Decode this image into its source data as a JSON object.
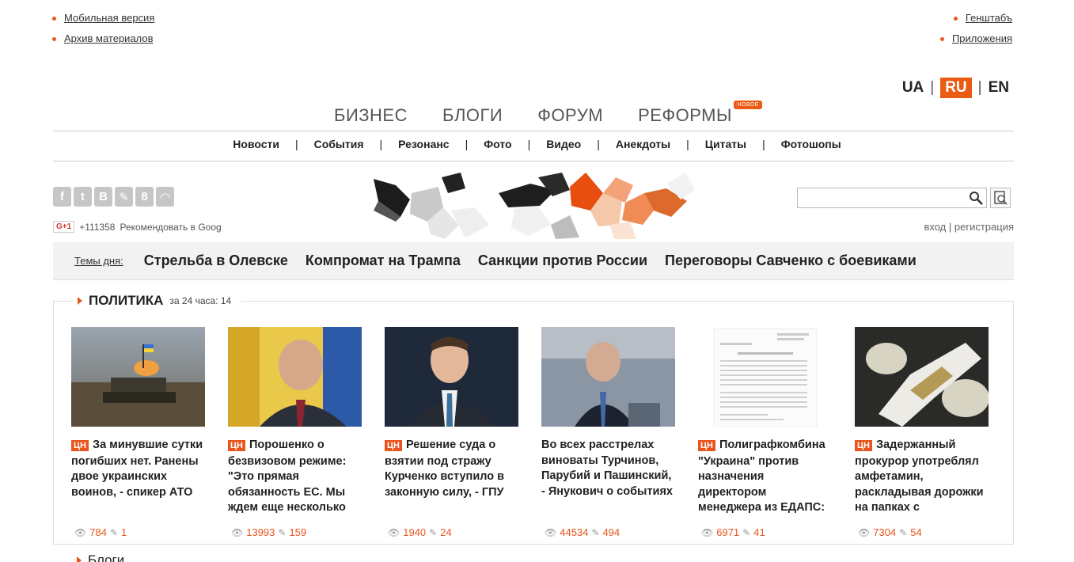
{
  "top_links_left": [
    "Мобильная версия",
    "Архив материалов"
  ],
  "top_links_right": [
    "Генштабъ",
    "Приложения"
  ],
  "languages": {
    "ua": "UA",
    "ru": "RU",
    "en": "EN",
    "sep": "|"
  },
  "main_nav": {
    "business": "БИЗНЕС",
    "blogs": "БЛОГИ",
    "forum": "ФОРУМ",
    "reforms": "РЕФОРМЫ",
    "new_badge": "НОВОЕ"
  },
  "sub_nav": [
    "Новости",
    "События",
    "Резонанс",
    "Фото",
    "Видео",
    "Анекдоты",
    "Цитаты",
    "Фотошопы"
  ],
  "sub_nav_sep": "|",
  "social_icons": [
    "facebook-icon",
    "twitter-icon",
    "vkontakte-icon",
    "livejournal-icon",
    "google-plus-icon",
    "rss-icon"
  ],
  "gplus": {
    "badge": "G+1",
    "count": "+111358",
    "text": "Рекомендовать в Goog"
  },
  "auth": {
    "login": "вход",
    "sep": "|",
    "register": "регистрация"
  },
  "topics": {
    "label": "Темы дня:",
    "items": [
      "Стрельба в Олевске",
      "Компромат на Трампа",
      "Санкции против России",
      "Переговоры Савченко с боевиками"
    ]
  },
  "section": {
    "title": "ПОЛИТИКА",
    "count_label": "за 24 часа: 14"
  },
  "cards": [
    {
      "tag": "ЦН",
      "headline": "За минувшие сутки погибших нет. Ранены двое украинских воинов, - спикер АТО",
      "views": "784",
      "comments": "1"
    },
    {
      "tag": "ЦН",
      "headline": "Порошенко о безвизовом режиме: \"Это прямая обязанность ЕС. Мы ждем еще несколько",
      "views": "13993",
      "comments": "159"
    },
    {
      "tag": "ЦН",
      "headline": "Решение суда о взятии под стражу Курченко вступило в законную силу, - ГПУ",
      "views": "1940",
      "comments": "24"
    },
    {
      "tag": "",
      "headline": "Во всех расстрелах виноваты Турчинов, Парубий и Пашинский, - Янукович о событиях",
      "views": "44534",
      "comments": "494"
    },
    {
      "tag": "ЦН",
      "headline": "Полиграфкомбина \"Украина\" против назначения директором менеджера из ЕДАПС:",
      "views": "6971",
      "comments": "41"
    },
    {
      "tag": "ЦН",
      "headline": "Задержанный прокурор употреблял амфетамин, раскладывая дорожки на папках с",
      "views": "7304",
      "comments": "54"
    }
  ],
  "next_section": {
    "title": "Блоги"
  },
  "colors": {
    "accent": "#e8561e"
  }
}
